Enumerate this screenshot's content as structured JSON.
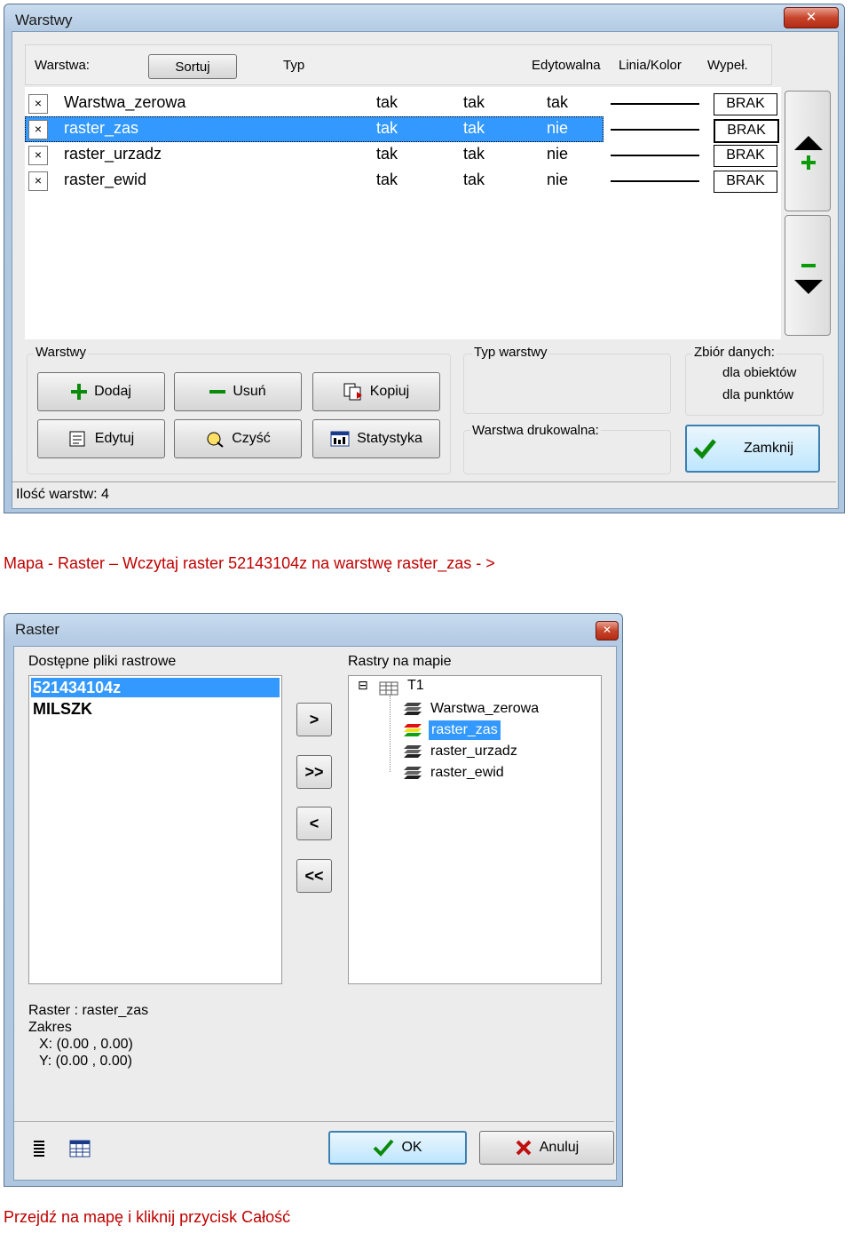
{
  "warstwy": {
    "title": "Warstwy",
    "close": "✕",
    "header": {
      "warstwa": "Warstwa:",
      "sortuj": "Sortuj",
      "typ": "Typ",
      "edytowalna": "Edytowalna",
      "linia": "Linia/Kolor",
      "wypel": "Wypeł."
    },
    "rows": [
      {
        "name": "Warstwa_zerowa",
        "c1": "tak",
        "c2": "tak",
        "c3": "tak",
        "fill": "BRAK"
      },
      {
        "name": "raster_zas",
        "c1": "tak",
        "c2": "tak",
        "c3": "nie",
        "fill": "BRAK"
      },
      {
        "name": "raster_urzadz",
        "c1": "tak",
        "c2": "tak",
        "c3": "nie",
        "fill": "BRAK"
      },
      {
        "name": "raster_ewid",
        "c1": "tak",
        "c2": "tak",
        "c3": "nie",
        "fill": "BRAK"
      }
    ],
    "checkbox_mark": "×",
    "group_warstwy": "Warstwy",
    "buttons": {
      "dodaj": "Dodaj",
      "usun": "Usuń",
      "kopiuj": "Kopiuj",
      "edytuj": "Edytuj",
      "czysc": "Czyść",
      "statystyka": "Statystyka",
      "zamknij": "Zamknij"
    },
    "typ_warstwy": "Typ warstwy",
    "warstwa_drukowalna": "Warstwa drukowalna:",
    "zbior_danych": "Zbiór danych:",
    "dla_obiektow": "dla obiektów",
    "dla_punktow": "dla punktów",
    "status": "Ilość warstw: 4",
    "selected_color": "#3399ff"
  },
  "caption1": "Mapa -  Raster – Wczytaj raster 52143104z na warstwę raster_zas -  >",
  "raster": {
    "title": "Raster",
    "close": "✕",
    "dostepne_label": "Dostępne pliki rastrowe",
    "files": [
      "521434104z",
      "MILSZK"
    ],
    "rastry_label": "Rastry na mapie",
    "tree_root": "T1",
    "tree_items": [
      "Warstwa_zerowa",
      "raster_zas",
      "raster_urzadz",
      "raster_ewid"
    ],
    "arrows": [
      ">",
      ">>",
      "<",
      "<<"
    ],
    "info_raster": "Raster : raster_zas",
    "info_zakres": "Zakres",
    "info_x": "X: (0.00 , 0.00)",
    "info_y": "Y: (0.00 , 0.00)",
    "ok": "OK",
    "anuluj": "Anuluj",
    "expander": "⊟"
  },
  "caption2": "Przejdź na mapę i kliknij przycisk Całość"
}
